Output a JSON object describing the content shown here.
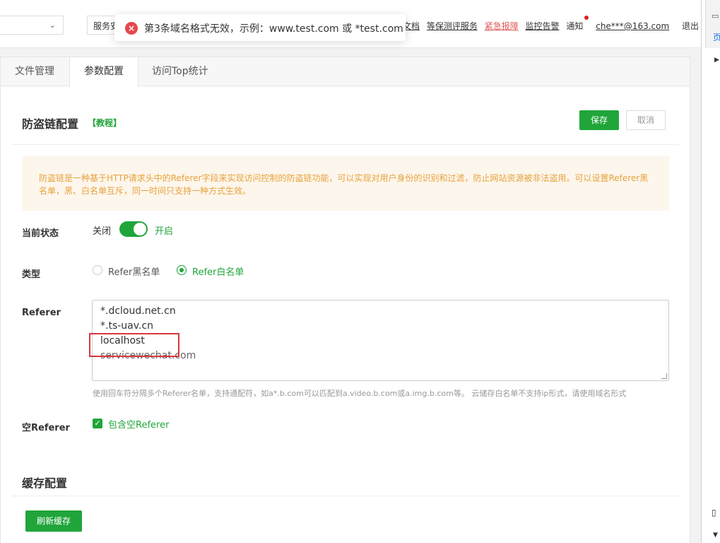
{
  "topbar": {
    "select1_value": "",
    "select2_value": "服务安",
    "links": [
      {
        "label": "文档",
        "style": "plain-underline"
      },
      {
        "label": "等保测评服务",
        "style": "underline"
      },
      {
        "label": "紧急报障",
        "style": "red"
      },
      {
        "label": "监控告警",
        "style": "underline"
      }
    ],
    "notify_label": "通知",
    "user_email": "che***@163.com",
    "logout_label": "退出"
  },
  "toast": {
    "message": "第3条域名格式无效，示例：www.test.com 或 *test.com",
    "icon": "error-circle-icon",
    "icon_glyph": "×"
  },
  "devpanel": {
    "top_text": "页"
  },
  "tabs": [
    {
      "label": "文件管理",
      "active": false
    },
    {
      "label": "参数配置",
      "active": true
    },
    {
      "label": "访问Top统计",
      "active": false
    }
  ],
  "hotlink": {
    "title": "防盗链配置",
    "tutorial_label": "【教程】",
    "save_label": "保存",
    "cancel_label": "取消",
    "notice": "防盗链是一种基于HTTP请求头中的Referer字段来实现访问控制的防盗链功能，可以实现对用户身份的识别和过滤，防止网站资源被非法盗用。可以设置Referer黑名单，黑、白名单互斥，同一时间只支持一种方式生效。",
    "status_label": "当前状态",
    "status_off": "关闭",
    "status_on": "开启",
    "status_enabled": true,
    "type_label": "类型",
    "type_options": [
      "Refer黑名单",
      "Refer白名单"
    ],
    "type_selected": "Refer白名单",
    "referer_label": "Referer",
    "referer_lines": [
      "*.dcloud.net.cn",
      "*.ts-uav.cn",
      "localhost",
      "servicewechat.com"
    ],
    "referer_hint": "使用回车符分隔多个Referer名单，支持通配符，如a*.b.com可以匹配到a.video.b.com或a.img.b.com等。 云储存白名单不支持ip形式，请使用域名形式",
    "empty_referer_label": "空Referer",
    "empty_referer_checkbox": "包含空Referer",
    "empty_referer_checked": true
  },
  "cache": {
    "title": "缓存配置",
    "refresh_label": "刷新缓存"
  },
  "colors": {
    "accent": "#20a53a",
    "error": "#e5484d",
    "notice_text": "#e6a23c",
    "notice_bg": "#fdf6ec"
  }
}
